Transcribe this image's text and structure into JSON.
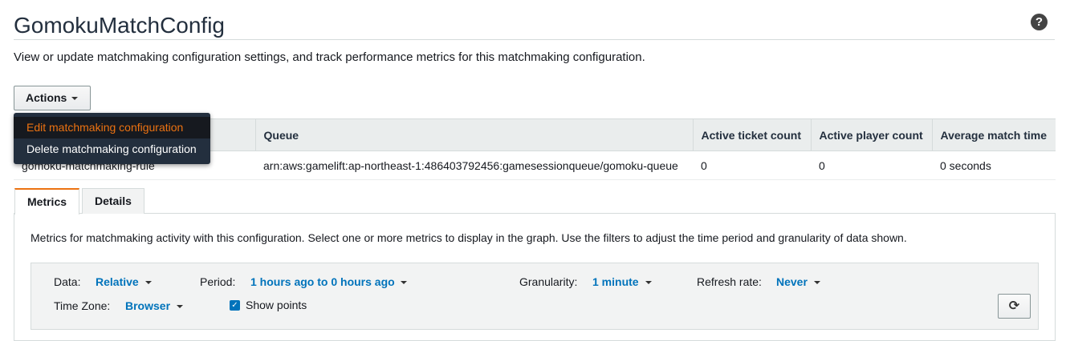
{
  "page": {
    "title": "GomokuMatchConfig",
    "description": "View or update matchmaking configuration settings, and track performance metrics for this matchmaking configuration.",
    "help_icon": "?"
  },
  "actions": {
    "label": "Actions",
    "menu": [
      {
        "label": "Edit matchmaking configuration"
      },
      {
        "label": "Delete matchmaking configuration"
      }
    ]
  },
  "table": {
    "columns": [
      "",
      "Queue",
      "Active ticket count",
      "Active player count",
      "Average match time"
    ],
    "rows": [
      {
        "rule": "gomoku-matchmaking-rule",
        "queue": "arn:aws:gamelift:ap-northeast-1:486403792456:gamesessionqueue/gomoku-queue",
        "active_ticket_count": "0",
        "active_player_count": "0",
        "average_match_time": "0 seconds"
      }
    ]
  },
  "tabs": [
    {
      "label": "Metrics"
    },
    {
      "label": "Details"
    }
  ],
  "metrics": {
    "description": "Metrics for matchmaking activity with this configuration. Select one or more metrics to display in the graph. Use the filters to adjust the time period and granularity of data shown.",
    "filters": {
      "data_label": "Data:",
      "data_value": "Relative",
      "period_label": "Period:",
      "period_value": "1 hours ago to 0 hours ago",
      "granularity_label": "Granularity:",
      "granularity_value": "1 minute",
      "refresh_label": "Refresh rate:",
      "refresh_value": "Never",
      "timezone_label": "Time Zone:",
      "timezone_value": "Browser",
      "show_points_label": "Show points",
      "show_points_checked": true
    },
    "refresh_icon": "refresh-icon"
  },
  "colors": {
    "accent": "#ec7211",
    "link": "#0073bb",
    "menu_bg": "#232f3e"
  }
}
